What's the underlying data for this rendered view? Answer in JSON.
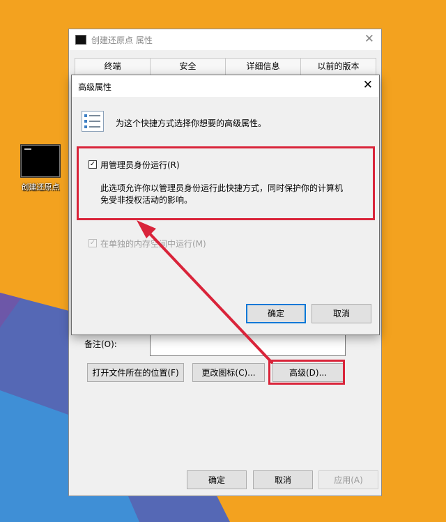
{
  "desktop": {
    "icon_label": "创建还原点"
  },
  "properties_window": {
    "title": "创建还原点 属性",
    "tabs": [
      "终端",
      "安全",
      "详细信息",
      "以前的版本"
    ],
    "remark_label": "备注(O):",
    "open_location_button": "打开文件所在的位置(F)",
    "change_icon_button": "更改图标(C)...",
    "advanced_button": "高级(D)...",
    "ok_button": "确定",
    "cancel_button": "取消",
    "apply_button": "应用(A)"
  },
  "advanced_dialog": {
    "title": "高级属性",
    "description": "为这个快捷方式选择你想要的高级属性。",
    "run_as_admin": {
      "label": "用管理员身份运行(R)",
      "checked": true,
      "explanation_line1": "此选项允许你以管理员身份运行此快捷方式，同时保护你的计算机",
      "explanation_line2": "免受非授权活动的影响。"
    },
    "separate_memory": {
      "label": "在单独的内存空间中运行(M)",
      "checked": true,
      "enabled": false
    },
    "ok_button": "确定",
    "cancel_button": "取消"
  },
  "colors": {
    "desktop_orange": "#f3a21f",
    "desktop_blue": "#5568b5",
    "highlight_red": "#d9243a",
    "focus_blue": "#0078d7"
  }
}
